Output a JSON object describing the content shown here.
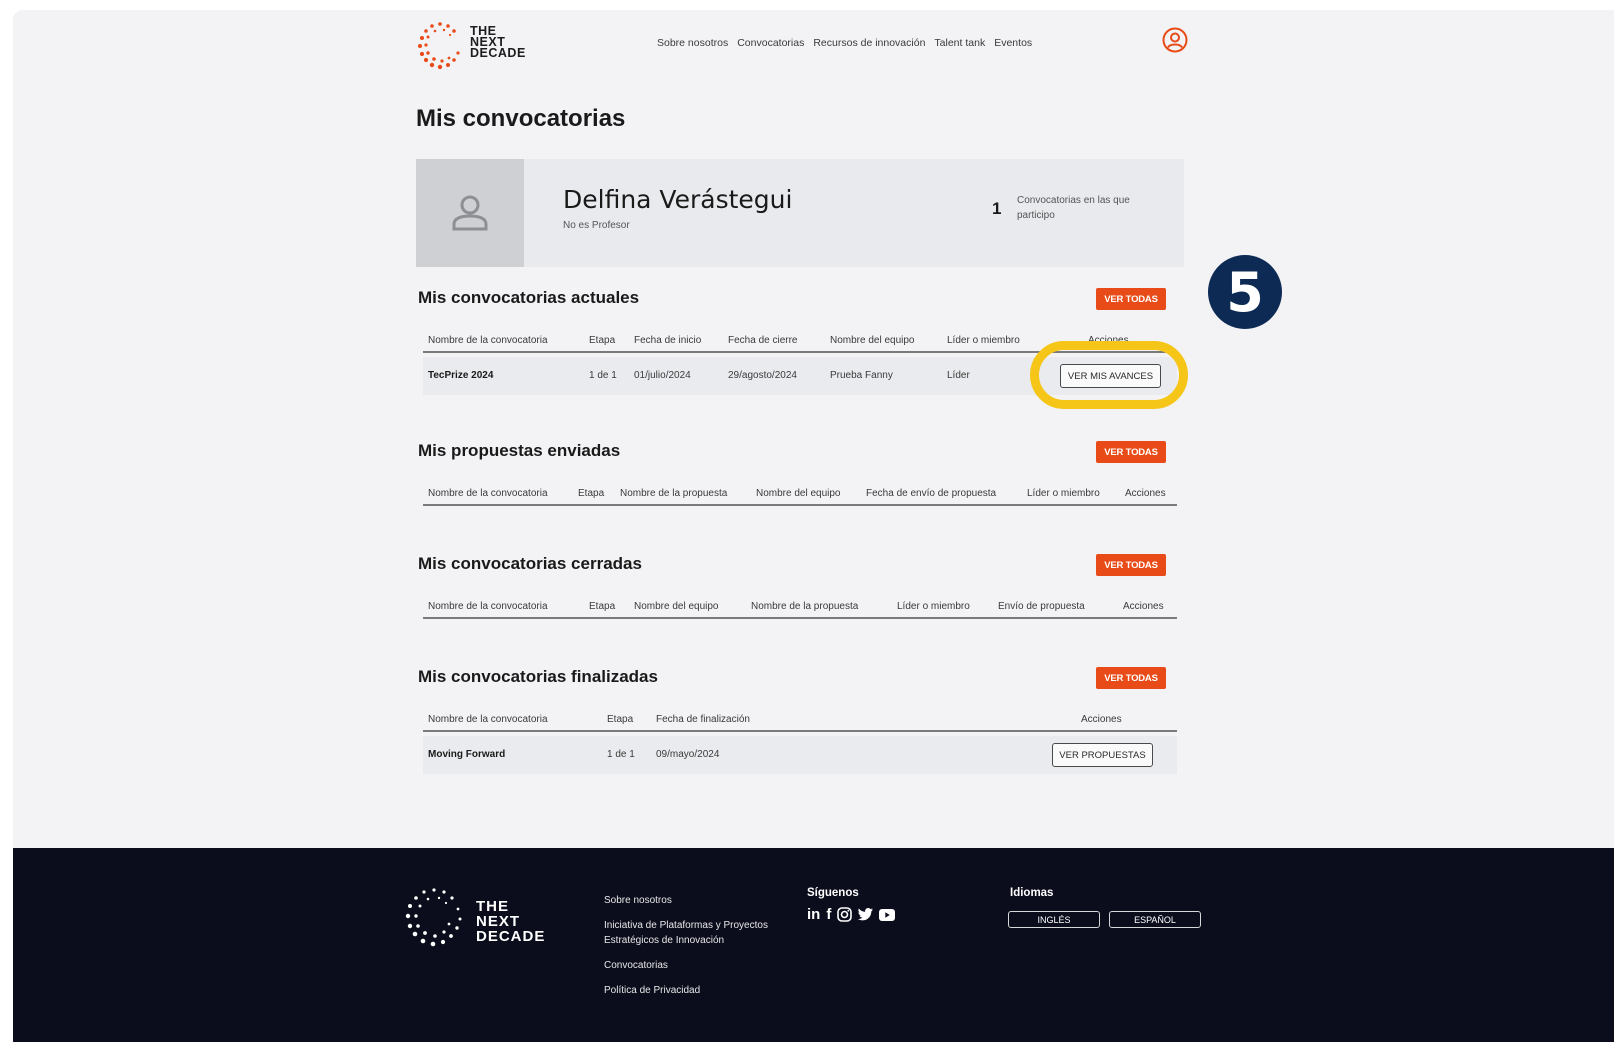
{
  "header": {
    "logo_line1": "THE",
    "logo_line2": "NEXT",
    "logo_line3": "DECADE",
    "nav": [
      "Sobre nosotros",
      "Convocatorias",
      "Recursos de innovación",
      "Talent tank",
      "Eventos"
    ]
  },
  "page_title": "Mis convocatorias",
  "profile": {
    "name": "Delfina Verástegui",
    "subtitle": "No es Profesor",
    "count": "1",
    "count_label": "Convocatorias en las que participo"
  },
  "sections": {
    "actuales": {
      "title": "Mis convocatorias actuales",
      "button": "VER TODAS",
      "columns": [
        "Nombre de la convocatoria",
        "Etapa",
        "Fecha de inicio",
        "Fecha de cierre",
        "Nombre del equipo",
        "Líder o miembro",
        "Acciones"
      ],
      "row": {
        "name": "TecPrize 2024",
        "etapa": "1 de 1",
        "inicio": "01/julio/2024",
        "cierre": "29/agosto/2024",
        "equipo": "Prueba Fanny",
        "rol": "Líder",
        "action": "VER MIS AVANCES"
      }
    },
    "enviadas": {
      "title": "Mis propuestas enviadas",
      "button": "VER TODAS",
      "columns": [
        "Nombre de la convocatoria",
        "Etapa",
        "Nombre de la propuesta",
        "Nombre del equipo",
        "Fecha de envío de propuesta",
        "Líder o miembro",
        "Acciones"
      ]
    },
    "cerradas": {
      "title": "Mis convocatorias cerradas",
      "button": "VER TODAS",
      "columns": [
        "Nombre de la convocatoria",
        "Etapa",
        "Nombre del equipo",
        "Nombre de la propuesta",
        "Líder o miembro",
        "Envío de propuesta",
        "Acciones"
      ]
    },
    "finalizadas": {
      "title": "Mis convocatorias finalizadas",
      "button": "VER TODAS",
      "columns": [
        "Nombre de la convocatoria",
        "Etapa",
        "Fecha de finalización",
        "Acciones"
      ],
      "row": {
        "name": "Moving Forward",
        "etapa": "1 de 1",
        "fecha": "09/mayo/2024",
        "action": "VER PROPUESTAS"
      }
    }
  },
  "step_badge": "5",
  "footer": {
    "links": [
      "Sobre nosotros",
      "Iniciativa de Plataformas y Proyectos",
      "Estratégicos de Innovación",
      "Convocatorias",
      "Política de Privacidad"
    ],
    "social_title": "Síguenos",
    "social_icons": [
      "linkedin-icon",
      "facebook-icon",
      "instagram-icon",
      "twitter-icon",
      "youtube-icon"
    ],
    "lang_title": "Idiomas",
    "lang_en": "INGLÉS",
    "lang_es": "ESPAÑOL"
  },
  "colors": {
    "accent": "#e84b17",
    "highlight": "#f5c518",
    "badge": "#0d2a54",
    "footer": "#0b0d1c"
  }
}
